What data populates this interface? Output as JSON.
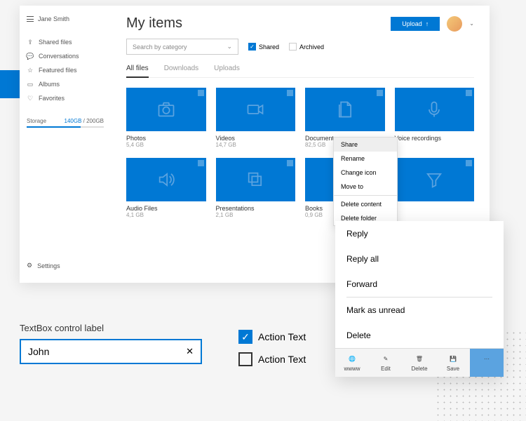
{
  "sidebar": {
    "user_name": "Jane Smith",
    "items": [
      {
        "label": "Shared files",
        "icon": "share"
      },
      {
        "label": "Conversations",
        "icon": "chat"
      },
      {
        "label": "Featured files",
        "icon": "star"
      },
      {
        "label": "Albums",
        "icon": "album"
      },
      {
        "label": "Favorites",
        "icon": "heart"
      }
    ],
    "storage": {
      "label": "Storage",
      "used": "140GB",
      "total": "200GB"
    },
    "settings_label": "Settings"
  },
  "header": {
    "title": "My items",
    "upload_label": "Upload"
  },
  "filters": {
    "category_placeholder": "Search by category",
    "shared_label": "Shared",
    "archived_label": "Archived"
  },
  "tabs": [
    "All files",
    "Downloads",
    "Uploads"
  ],
  "tiles": [
    {
      "name": "Photos",
      "size": "5,4 GB",
      "icon": "camera"
    },
    {
      "name": "Videos",
      "size": "14,7 GB",
      "icon": "video"
    },
    {
      "name": "Documents",
      "size": "82,5 GB",
      "icon": "document"
    },
    {
      "name": "Voice recordings",
      "size": "",
      "icon": "mic"
    },
    {
      "name": "Audio Files",
      "size": "4,1 GB",
      "icon": "speaker"
    },
    {
      "name": "Presentations",
      "size": "2,1 GB",
      "icon": "layers"
    },
    {
      "name": "Books",
      "size": "0,9 GB",
      "icon": "book"
    },
    {
      "name": "",
      "size": "",
      "icon": "funnel"
    }
  ],
  "context_menu": [
    "Share",
    "Rename",
    "Change icon",
    "Move to",
    "Delete content",
    "Delete folder"
  ],
  "popup": {
    "items": [
      "Reply",
      "Reply all",
      "Forward",
      "Mark as unread",
      "Delete"
    ],
    "toolbar": [
      {
        "label": "wwww",
        "icon": "globe"
      },
      {
        "label": "Edit",
        "icon": "pencil"
      },
      {
        "label": "Delete",
        "icon": "trash"
      },
      {
        "label": "Save",
        "icon": "save"
      },
      {
        "label": "",
        "icon": "more"
      }
    ]
  },
  "textbox": {
    "label": "TextBox control label",
    "value": "John"
  },
  "actions": [
    {
      "label": "Action Text",
      "checked": true
    },
    {
      "label": "Action Text",
      "checked": false
    }
  ]
}
